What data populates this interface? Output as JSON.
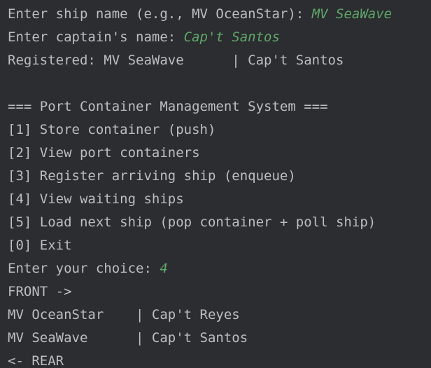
{
  "colors": {
    "background": "#2b2d30",
    "text": "#bcbec4",
    "user_input": "#5fa86a"
  },
  "console": {
    "lines": [
      {
        "prompt": "Enter ship name (e.g., MV OceanStar): ",
        "input": "MV SeaWave"
      },
      {
        "prompt": "Enter captain's name: ",
        "input": "Cap't Santos"
      },
      {
        "prompt": "Registered: MV SeaWave      | Cap't Santos",
        "input": ""
      },
      {
        "prompt": "",
        "input": ""
      },
      {
        "prompt": "=== Port Container Management System ===",
        "input": ""
      },
      {
        "prompt": "[1] Store container (push)",
        "input": ""
      },
      {
        "prompt": "[2] View port containers",
        "input": ""
      },
      {
        "prompt": "[3] Register arriving ship (enqueue)",
        "input": ""
      },
      {
        "prompt": "[4] View waiting ships",
        "input": ""
      },
      {
        "prompt": "[5] Load next ship (pop container + poll ship)",
        "input": ""
      },
      {
        "prompt": "[0] Exit",
        "input": ""
      },
      {
        "prompt": "Enter your choice: ",
        "input": "4"
      },
      {
        "prompt": "FRONT ->",
        "input": ""
      },
      {
        "prompt": "MV OceanStar    | Cap't Reyes",
        "input": ""
      },
      {
        "prompt": "MV SeaWave      | Cap't Santos",
        "input": ""
      },
      {
        "prompt": "<- REAR",
        "input": ""
      }
    ]
  }
}
